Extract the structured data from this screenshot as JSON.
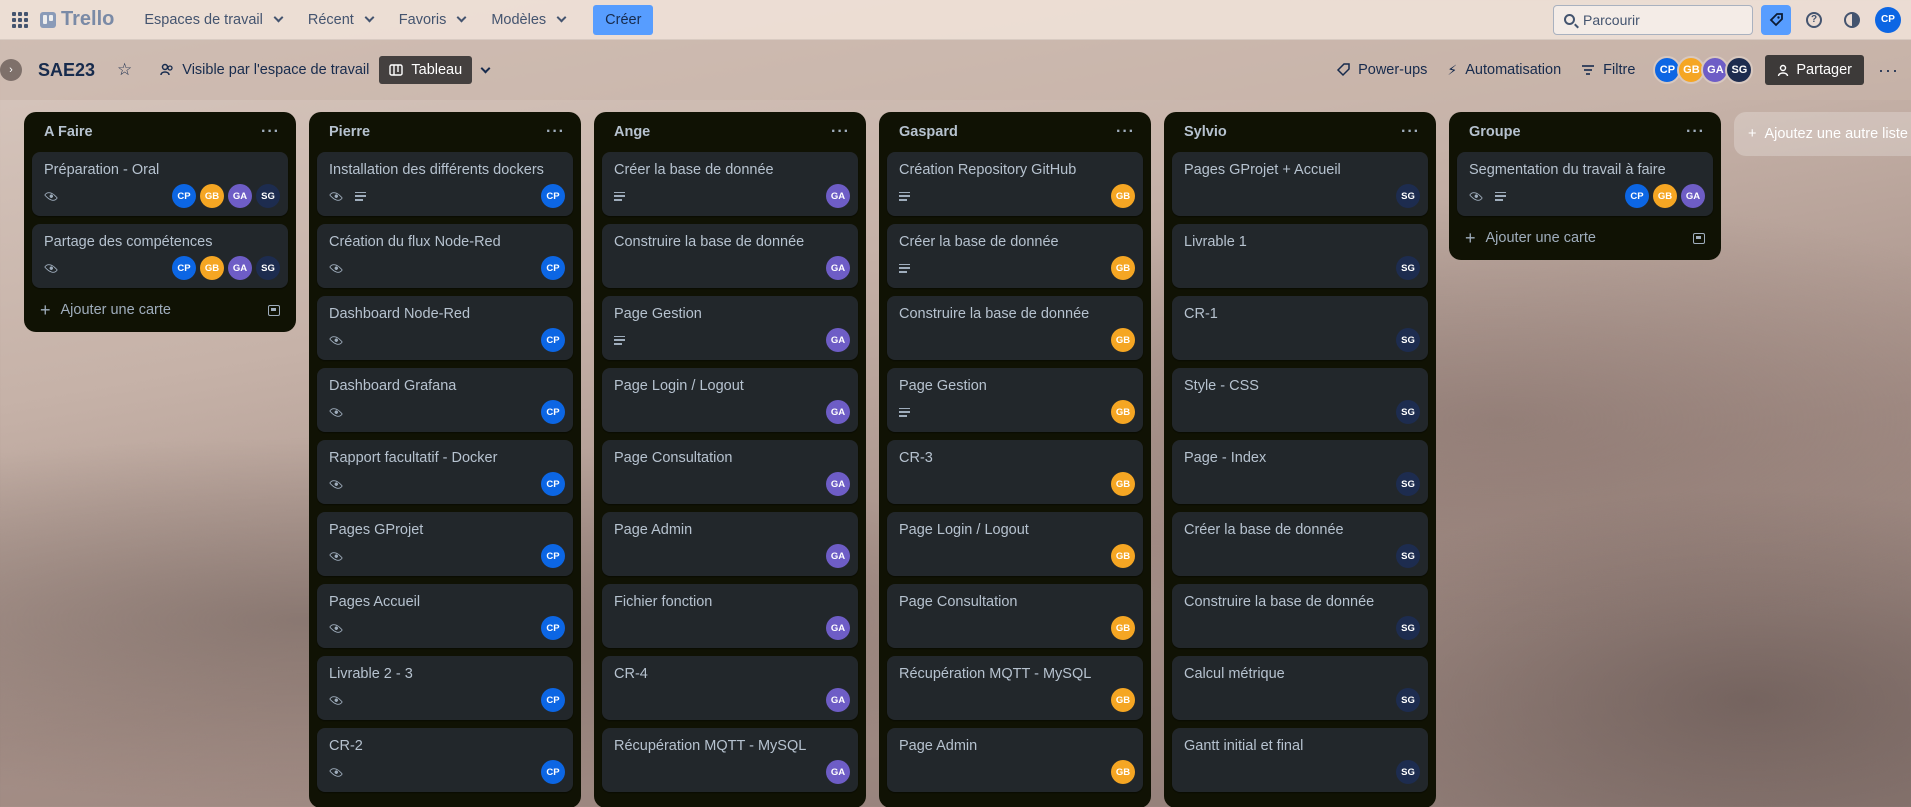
{
  "topbar": {
    "logo": "Trello",
    "menus": [
      "Espaces de travail",
      "Récent",
      "Favoris",
      "Modèles"
    ],
    "create_label": "Créer",
    "search_placeholder": "Parcourir",
    "user_initials": "CP"
  },
  "board": {
    "title": "SAE23",
    "visibility_label": "Visible par l'espace de travail",
    "view_label": "Tableau",
    "powerups_label": "Power-ups",
    "automation_label": "Automatisation",
    "filter_label": "Filtre",
    "share_label": "Partager",
    "members": [
      "CP",
      "GB",
      "GA",
      "SG"
    ]
  },
  "add_card_label": "Ajouter une carte",
  "add_list_label": "Ajoutez une autre liste",
  "colors": {
    "CP": "#0c66e4",
    "GB": "#f5a623",
    "GA": "#6e5dc6",
    "SG": "#1d2c4f"
  },
  "lists": [
    {
      "title": "A Faire",
      "show_add": true,
      "cards": [
        {
          "title": "Préparation - Oral",
          "badges": [
            "eye"
          ],
          "members": [
            "CP",
            "GB",
            "GA",
            "SG"
          ]
        },
        {
          "title": "Partage des compétences",
          "badges": [
            "eye"
          ],
          "members": [
            "CP",
            "GB",
            "GA",
            "SG"
          ]
        }
      ]
    },
    {
      "title": "Pierre",
      "show_add": false,
      "cards": [
        {
          "title": "Installation des différents dockers",
          "badges": [
            "eye",
            "desc"
          ],
          "members": [
            "CP"
          ]
        },
        {
          "title": "Création du flux Node-Red",
          "badges": [
            "eye"
          ],
          "members": [
            "CP"
          ]
        },
        {
          "title": "Dashboard Node-Red",
          "badges": [
            "eye"
          ],
          "members": [
            "CP"
          ]
        },
        {
          "title": "Dashboard Grafana",
          "badges": [
            "eye"
          ],
          "members": [
            "CP"
          ]
        },
        {
          "title": "Rapport facultatif - Docker",
          "badges": [
            "eye"
          ],
          "members": [
            "CP"
          ]
        },
        {
          "title": "Pages GProjet",
          "badges": [
            "eye"
          ],
          "members": [
            "CP"
          ]
        },
        {
          "title": "Pages Accueil",
          "badges": [
            "eye"
          ],
          "members": [
            "CP"
          ]
        },
        {
          "title": "Livrable 2 - 3",
          "badges": [
            "eye"
          ],
          "members": [
            "CP"
          ]
        },
        {
          "title": "CR-2",
          "badges": [
            "eye"
          ],
          "members": [
            "CP"
          ]
        }
      ]
    },
    {
      "title": "Ange",
      "show_add": false,
      "cards": [
        {
          "title": "Créer la base de donnée",
          "badges": [
            "desc"
          ],
          "members": [
            "GA"
          ]
        },
        {
          "title": "Construire la base de donnée",
          "badges": [],
          "members": [
            "GA"
          ]
        },
        {
          "title": "Page Gestion",
          "badges": [
            "desc"
          ],
          "members": [
            "GA"
          ]
        },
        {
          "title": "Page Login / Logout",
          "badges": [],
          "members": [
            "GA"
          ]
        },
        {
          "title": "Page Consultation",
          "badges": [],
          "members": [
            "GA"
          ]
        },
        {
          "title": "Page Admin",
          "badges": [],
          "members": [
            "GA"
          ]
        },
        {
          "title": "Fichier fonction",
          "badges": [],
          "members": [
            "GA"
          ]
        },
        {
          "title": "CR-4",
          "badges": [],
          "members": [
            "GA"
          ]
        },
        {
          "title": "Récupération MQTT - MySQL",
          "badges": [],
          "members": [
            "GA"
          ]
        }
      ]
    },
    {
      "title": "Gaspard",
      "show_add": false,
      "cards": [
        {
          "title": "Création Repository GitHub",
          "badges": [
            "desc"
          ],
          "members": [
            "GB"
          ]
        },
        {
          "title": "Créer la base de donnée",
          "badges": [
            "desc"
          ],
          "members": [
            "GB"
          ]
        },
        {
          "title": "Construire la base de donnée",
          "badges": [],
          "members": [
            "GB"
          ]
        },
        {
          "title": "Page Gestion",
          "badges": [
            "desc"
          ],
          "members": [
            "GB"
          ]
        },
        {
          "title": "CR-3",
          "badges": [],
          "members": [
            "GB"
          ]
        },
        {
          "title": "Page Login / Logout",
          "badges": [],
          "members": [
            "GB"
          ]
        },
        {
          "title": "Page Consultation",
          "badges": [],
          "members": [
            "GB"
          ]
        },
        {
          "title": "Récupération MQTT - MySQL",
          "badges": [],
          "members": [
            "GB"
          ]
        },
        {
          "title": "Page Admin",
          "badges": [],
          "members": [
            "GB"
          ]
        }
      ]
    },
    {
      "title": "Sylvio",
      "show_add": false,
      "cards": [
        {
          "title": "Pages GProjet + Accueil",
          "badges": [],
          "members": [
            "SG"
          ]
        },
        {
          "title": "Livrable 1",
          "badges": [],
          "members": [
            "SG"
          ]
        },
        {
          "title": "CR-1",
          "badges": [],
          "members": [
            "SG"
          ]
        },
        {
          "title": "Style - CSS",
          "badges": [],
          "members": [
            "SG"
          ]
        },
        {
          "title": "Page - Index",
          "badges": [],
          "members": [
            "SG"
          ]
        },
        {
          "title": "Créer la base de donnée",
          "badges": [],
          "members": [
            "SG"
          ]
        },
        {
          "title": "Construire la base de donnée",
          "badges": [],
          "members": [
            "SG"
          ]
        },
        {
          "title": "Calcul métrique",
          "badges": [],
          "members": [
            "SG"
          ]
        },
        {
          "title": "Gantt initial et final",
          "badges": [],
          "members": [
            "SG"
          ]
        }
      ]
    },
    {
      "title": "Groupe",
      "show_add": true,
      "cards": [
        {
          "title": "Segmentation du travail à faire",
          "badges": [
            "eye",
            "desc"
          ],
          "members": [
            "CP",
            "GB",
            "GA"
          ]
        }
      ]
    }
  ]
}
